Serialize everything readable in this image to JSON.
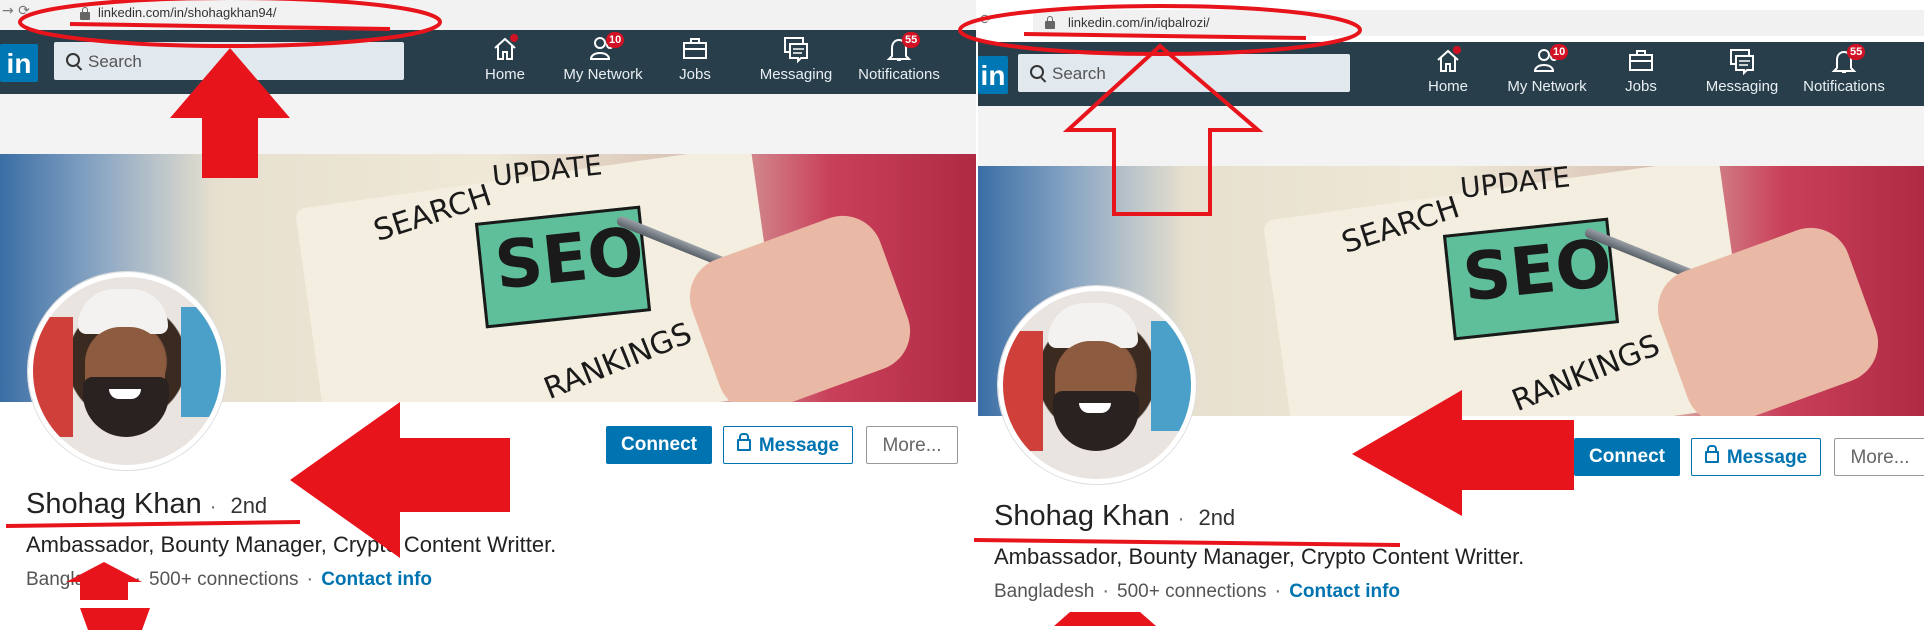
{
  "colors": {
    "annotation_red": "#e8141c",
    "linkedin_blue": "#0073b1",
    "navbar": "#283e4a"
  },
  "nav": {
    "items": [
      {
        "label": "Home",
        "icon": "home-icon",
        "badge": ""
      },
      {
        "label": "My Network",
        "icon": "network-icon",
        "badge": "10"
      },
      {
        "label": "Jobs",
        "icon": "briefcase-icon",
        "badge": ""
      },
      {
        "label": "Messaging",
        "icon": "messaging-icon",
        "badge": ""
      },
      {
        "label": "Notifications",
        "icon": "bell-icon",
        "badge": "55"
      }
    ],
    "search_placeholder": "Search",
    "logo": "in"
  },
  "panels": [
    {
      "url": "linkedin.com/in/shohagkhan94/",
      "name": "Shohag Khan",
      "degree": "2nd",
      "headline": "Ambassador, Bounty Manager, Crypto Content Writter.",
      "location": "Bangladesh",
      "connections": "500+ connections",
      "contact": "Contact info",
      "buttons": {
        "connect": "Connect",
        "message": "Message",
        "more": "More..."
      }
    },
    {
      "url": "linkedin.com/in/iqbalrozi/",
      "name": "Shohag Khan",
      "degree": "2nd",
      "headline": "Ambassador, Bounty Manager, Crypto Content Writter.",
      "location": "Bangladesh",
      "connections": "500+ connections",
      "contact": "Contact info",
      "buttons": {
        "connect": "Connect",
        "message": "Message",
        "more": "More..."
      }
    }
  ],
  "cover_text": {
    "search": "SEARCH",
    "update": "UPDATE",
    "seo": "SEO",
    "rankings": "RANKINGS"
  },
  "separator": "·"
}
